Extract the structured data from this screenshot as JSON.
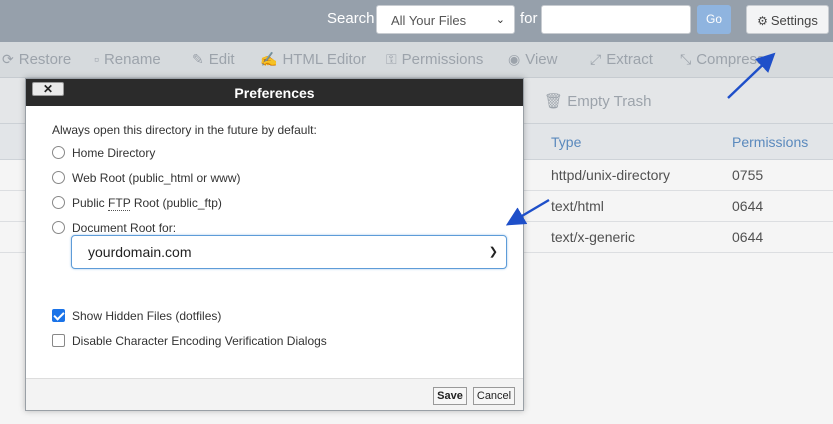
{
  "topbar": {
    "search_label": "Search",
    "scope_value": "All Your Files",
    "for_label": "for",
    "search_value": "",
    "go_label": "Go",
    "settings_label": "Settings"
  },
  "toolbar": {
    "items": [
      {
        "label": "Restore",
        "icon": "restore-icon"
      },
      {
        "label": "Rename",
        "icon": "rename-icon"
      },
      {
        "label": "Edit",
        "icon": "pencil-icon"
      },
      {
        "label": "HTML Editor",
        "icon": "html-editor-icon"
      },
      {
        "label": "Permissions",
        "icon": "key-icon"
      },
      {
        "label": "View",
        "icon": "eye-icon"
      },
      {
        "label": "Extract",
        "icon": "extract-icon"
      },
      {
        "label": "Compress",
        "icon": "compress-icon"
      }
    ],
    "empty_trash": "Empty Trash"
  },
  "table": {
    "columns": [
      "Type",
      "Permissions"
    ],
    "rows": [
      {
        "type": "httpd/unix-directory",
        "permissions": "0755"
      },
      {
        "type": "text/html",
        "permissions": "0644"
      },
      {
        "type": "text/x-generic",
        "permissions": "0644"
      }
    ]
  },
  "dialog": {
    "title": "Preferences",
    "close_label": "✕",
    "intro": "Always open this directory in the future by default:",
    "options": {
      "home": "Home Directory",
      "webroot": "Web Root (public_html or www)",
      "ftp_prefix": "Public ",
      "ftp_abbr": "FTP",
      "ftp_suffix": " Root (public_ftp)",
      "docroot": "Document Root for:"
    },
    "domain_value": "yourdomain.com",
    "show_hidden": {
      "label": "Show Hidden Files (dotfiles)",
      "checked": true
    },
    "disable_encoding": {
      "label": "Disable Character Encoding Verification Dialogs",
      "checked": false
    },
    "save_label": "Save",
    "cancel_label": "Cancel"
  },
  "colors": {
    "annotation_arrow": "#1e4fc9",
    "header_link": "#5e8fc5",
    "checkbox_on": "#1a73e8"
  }
}
